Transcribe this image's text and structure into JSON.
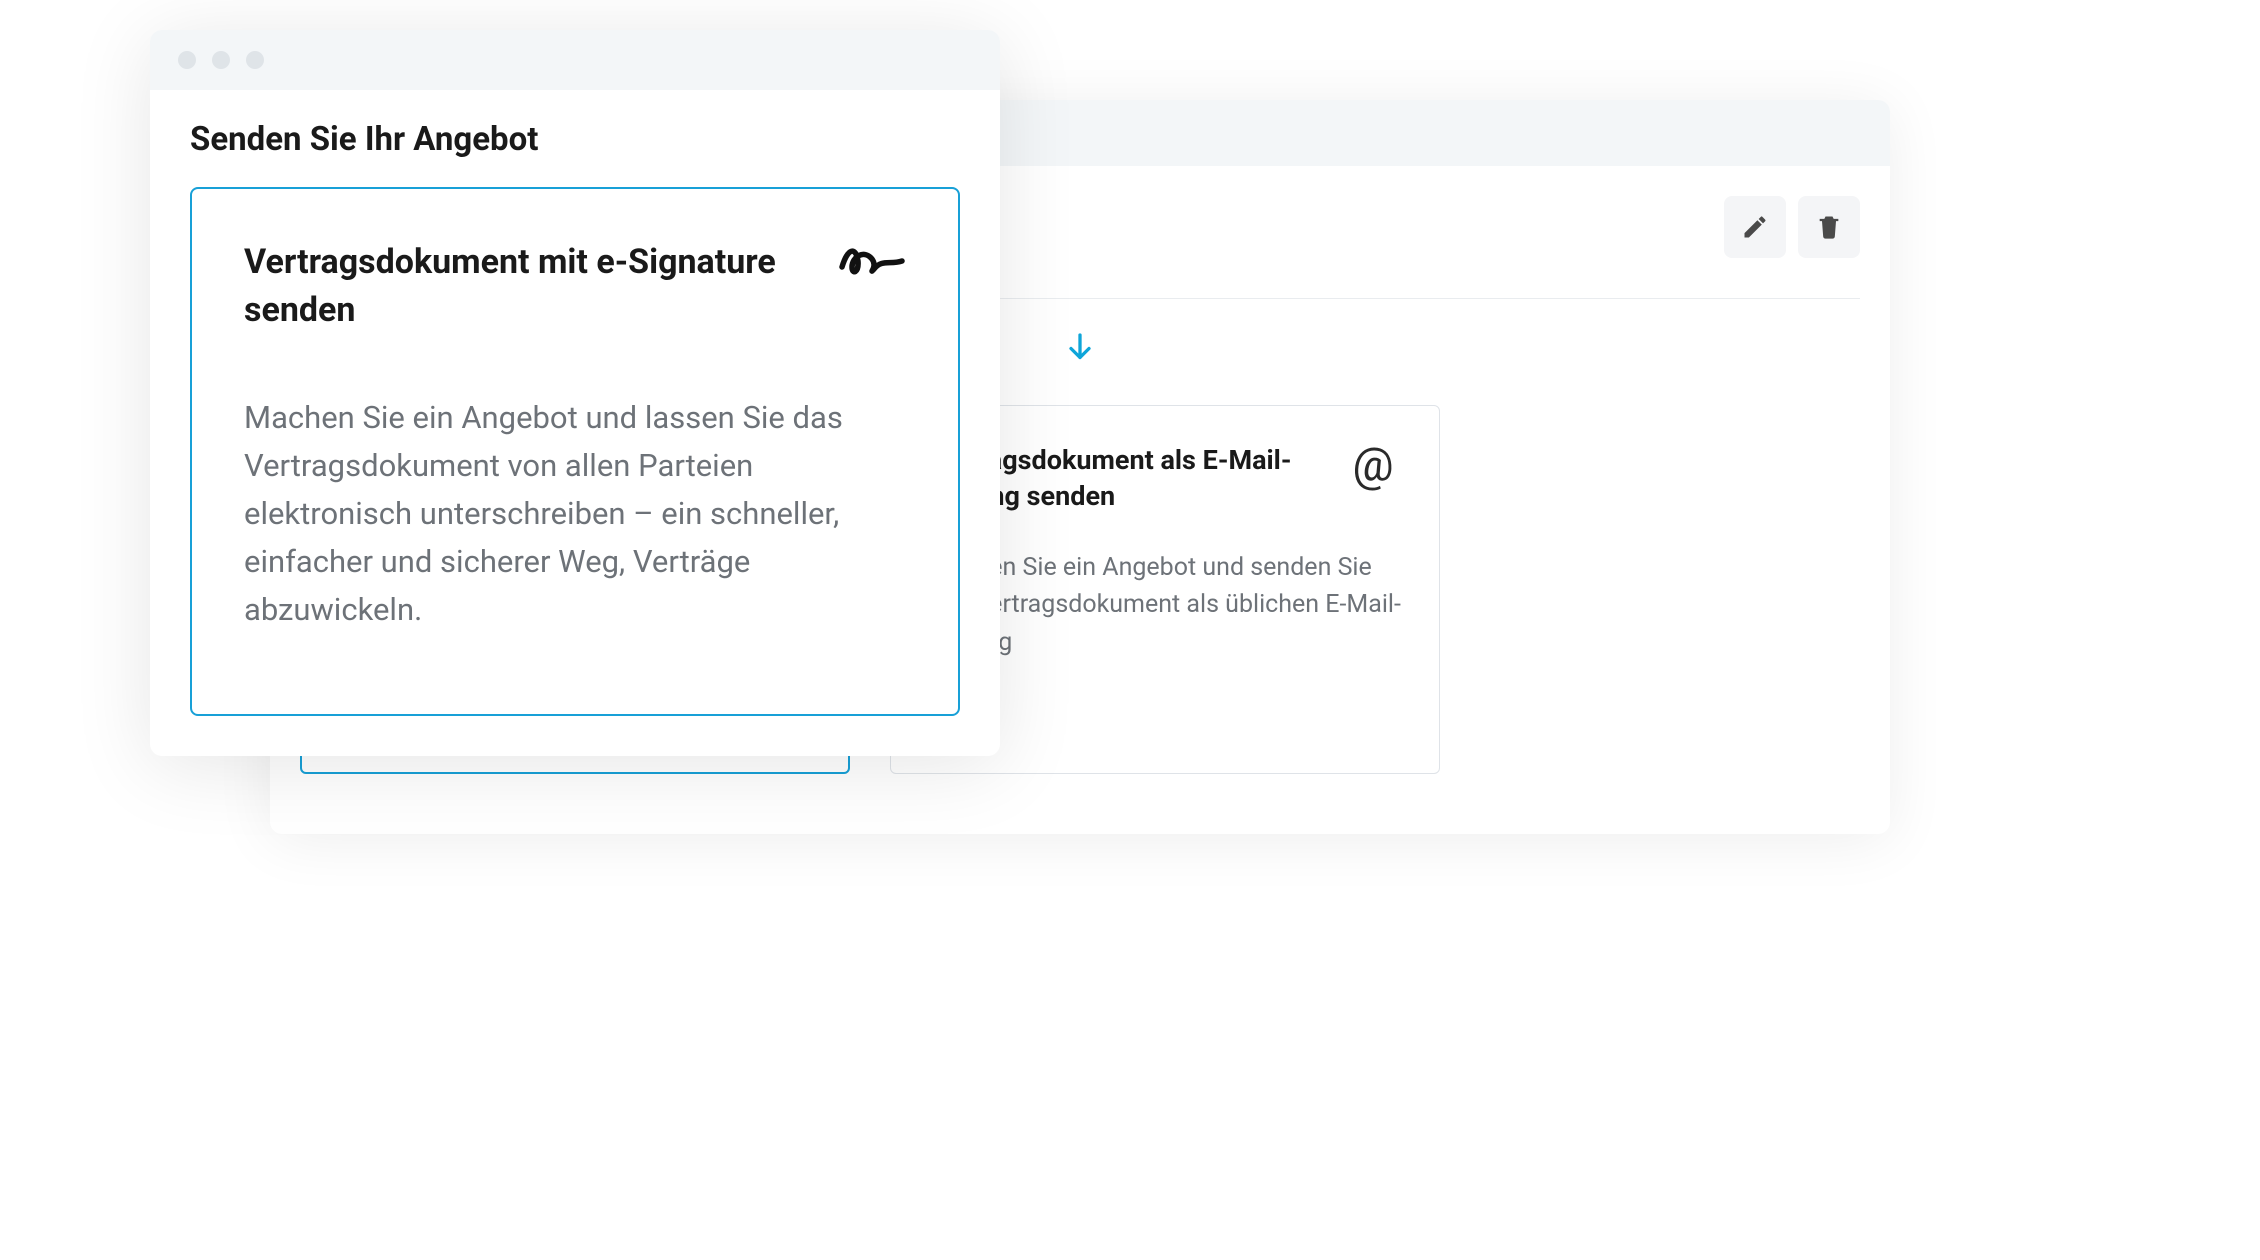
{
  "modal": {
    "title": "Senden Sie Ihr Angebot",
    "options": [
      {
        "title": "Vertragsdokument mit e-Signature senden",
        "description": "Machen Sie ein Angebot und lassen Sie das Vertragsdokument von allen Parteien elektronisch unterschreiben – ein schneller, einfacher und sicherer Weg, Verträge abzuwickeln.",
        "icon": "signature-icon",
        "selected": true
      },
      {
        "title": "Vertragsdokument als E-Mail-Anhang senden",
        "description": "Machen Sie ein Angebot und senden Sie das Vertragsdokument als üblichen E-Mail-Anhang",
        "icon": "at-icon",
        "selected": false
      }
    ]
  },
  "background_panel": {
    "actions": {
      "edit": "edit",
      "delete": "delete"
    },
    "partial_visible_text": "unterschreiben – ein schneller, einfacher und sicherer Weg, Verträge abzuwickeln."
  },
  "colors": {
    "accent": "#18a0d7",
    "text_primary": "#1a1a1a",
    "text_secondary": "#6d7278",
    "chrome_bg": "#f3f6f8"
  }
}
